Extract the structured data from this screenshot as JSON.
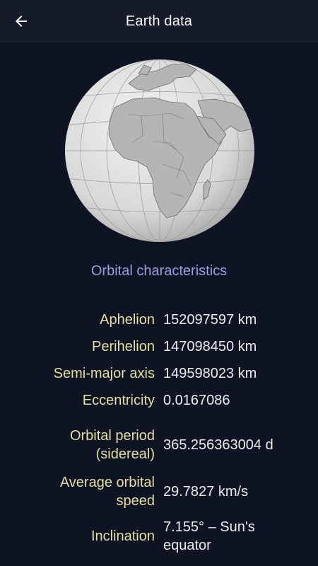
{
  "header": {
    "title": "Earth data",
    "back_icon": "arrow-left-icon"
  },
  "globe": {
    "icon": "globe-africa-europe-icon",
    "ocean_color": "#dcdcdc",
    "land_color": "#b9b9b9"
  },
  "section": {
    "title": "Orbital characteristics"
  },
  "rows": [
    {
      "label": "Aphelion",
      "value": "152097597 km"
    },
    {
      "label": "Perihelion",
      "value": "147098450 km"
    },
    {
      "label": "Semi-major axis",
      "value": "149598023 km"
    },
    {
      "label": "Eccentricity",
      "value": "0.0167086"
    },
    {
      "label1": "Orbital period",
      "label2": "(sidereal)",
      "value": "365.256363004 d"
    },
    {
      "label1": "Average orbital",
      "label2": "speed",
      "value": "29.7827 km/s"
    },
    {
      "label": "Inclination",
      "value1": "7.155° – Sun's",
      "value2": "equator"
    }
  ],
  "colors": {
    "background": "#0f1424",
    "appbar": "#151b2b",
    "label": "#e6dfa0",
    "section_title": "#9a9fe0"
  }
}
